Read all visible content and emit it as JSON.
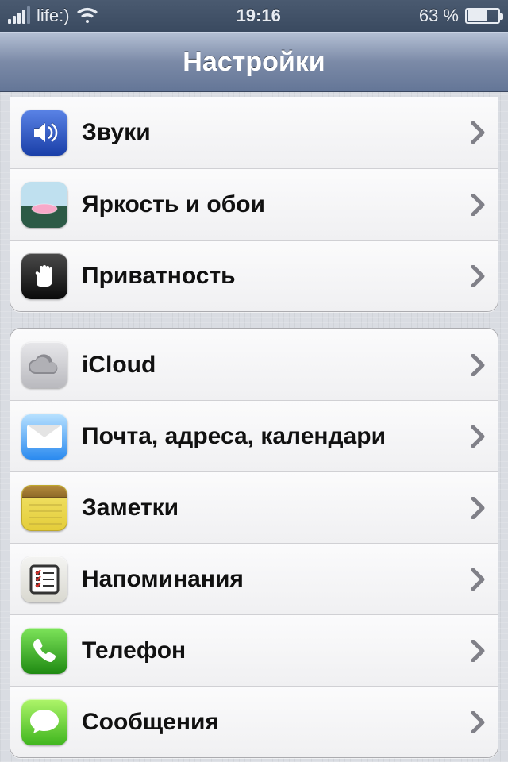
{
  "statusbar": {
    "carrier": "life:)",
    "time": "19:16",
    "battery_text": "63 %",
    "battery_percent": 63
  },
  "navbar": {
    "title": "Настройки"
  },
  "group1": {
    "items": [
      {
        "label": "Звуки",
        "icon": "sound-icon"
      },
      {
        "label": "Яркость и обои",
        "icon": "wallpaper-icon"
      },
      {
        "label": "Приватность",
        "icon": "privacy-icon"
      }
    ]
  },
  "group2": {
    "items": [
      {
        "label": "iCloud",
        "icon": "icloud-icon",
        "highlighted": true
      },
      {
        "label": "Почта, адреса, календари",
        "icon": "mail-icon"
      },
      {
        "label": "Заметки",
        "icon": "notes-icon"
      },
      {
        "label": "Напоминания",
        "icon": "reminders-icon"
      },
      {
        "label": "Телефон",
        "icon": "phone-icon"
      },
      {
        "label": "Сообщения",
        "icon": "messages-icon"
      }
    ]
  }
}
